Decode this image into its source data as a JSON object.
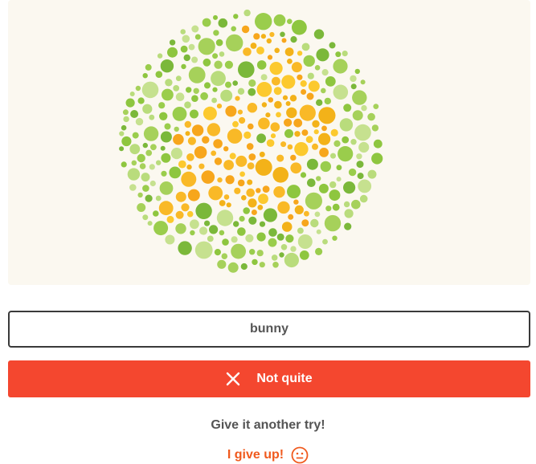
{
  "plate": {
    "background": "#fbf8f0",
    "hidden_shape_colors": [
      "#f7a61c",
      "#f9b927",
      "#fcc92e",
      "#f3b219"
    ],
    "field_colors": [
      "#8ec63f",
      "#a6d15a",
      "#b9dc7c",
      "#7bb83a",
      "#c6e18f",
      "#9acd4c"
    ]
  },
  "answer": {
    "value": "bunny"
  },
  "result": {
    "label": "Not quite",
    "color": "#f4472f",
    "icon": "x-icon"
  },
  "hint": {
    "text": "Give it another try!"
  },
  "give_up": {
    "label": "I give up!",
    "icon": "neutral-face-icon",
    "color": "#f05a1e"
  }
}
